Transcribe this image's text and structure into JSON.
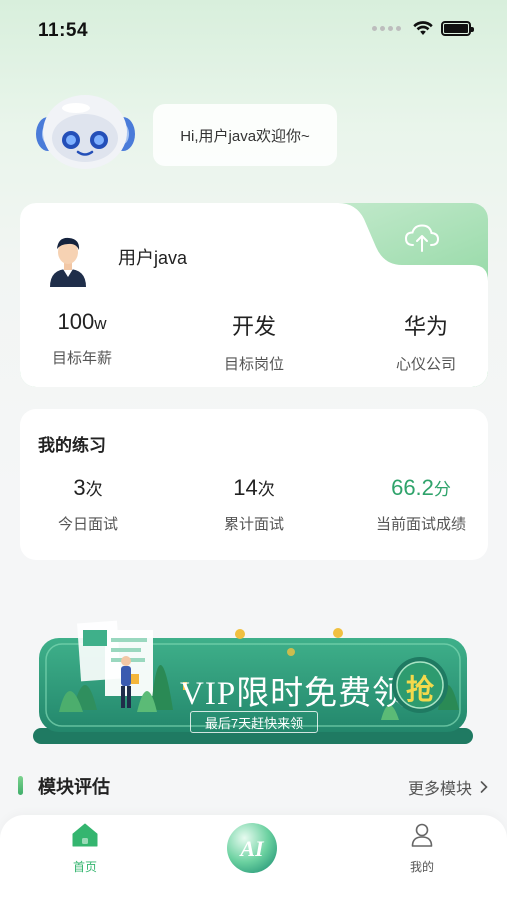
{
  "status": {
    "time": "11:54"
  },
  "greeting": "Hi,用户java欢迎你~",
  "profile": {
    "username": "用户java",
    "stats": [
      {
        "value": "100",
        "unit": "w",
        "label": "目标年薪"
      },
      {
        "value": "开发",
        "unit": "",
        "label": "目标岗位"
      },
      {
        "value": "华为",
        "unit": "",
        "label": "心仪公司"
      }
    ]
  },
  "practice": {
    "title": "我的练习",
    "stats": [
      {
        "value": "3",
        "unit": "次",
        "label": "今日面试"
      },
      {
        "value": "14",
        "unit": "次",
        "label": "累计面试"
      },
      {
        "value": "66.2",
        "unit": "分",
        "label": "当前面试成绩"
      }
    ]
  },
  "banner": {
    "title": "VIP限时免费领",
    "subtitle": "最后7天赶快来领",
    "button": "抢"
  },
  "section": {
    "title": "模块评估",
    "more": "更多模块"
  },
  "tabbar": {
    "home": "首页",
    "ai": "AI",
    "mine": "我的"
  },
  "colors": {
    "accent": "#2fa36b",
    "banner": "#2f9e7d",
    "gold": "#f3d94c"
  }
}
